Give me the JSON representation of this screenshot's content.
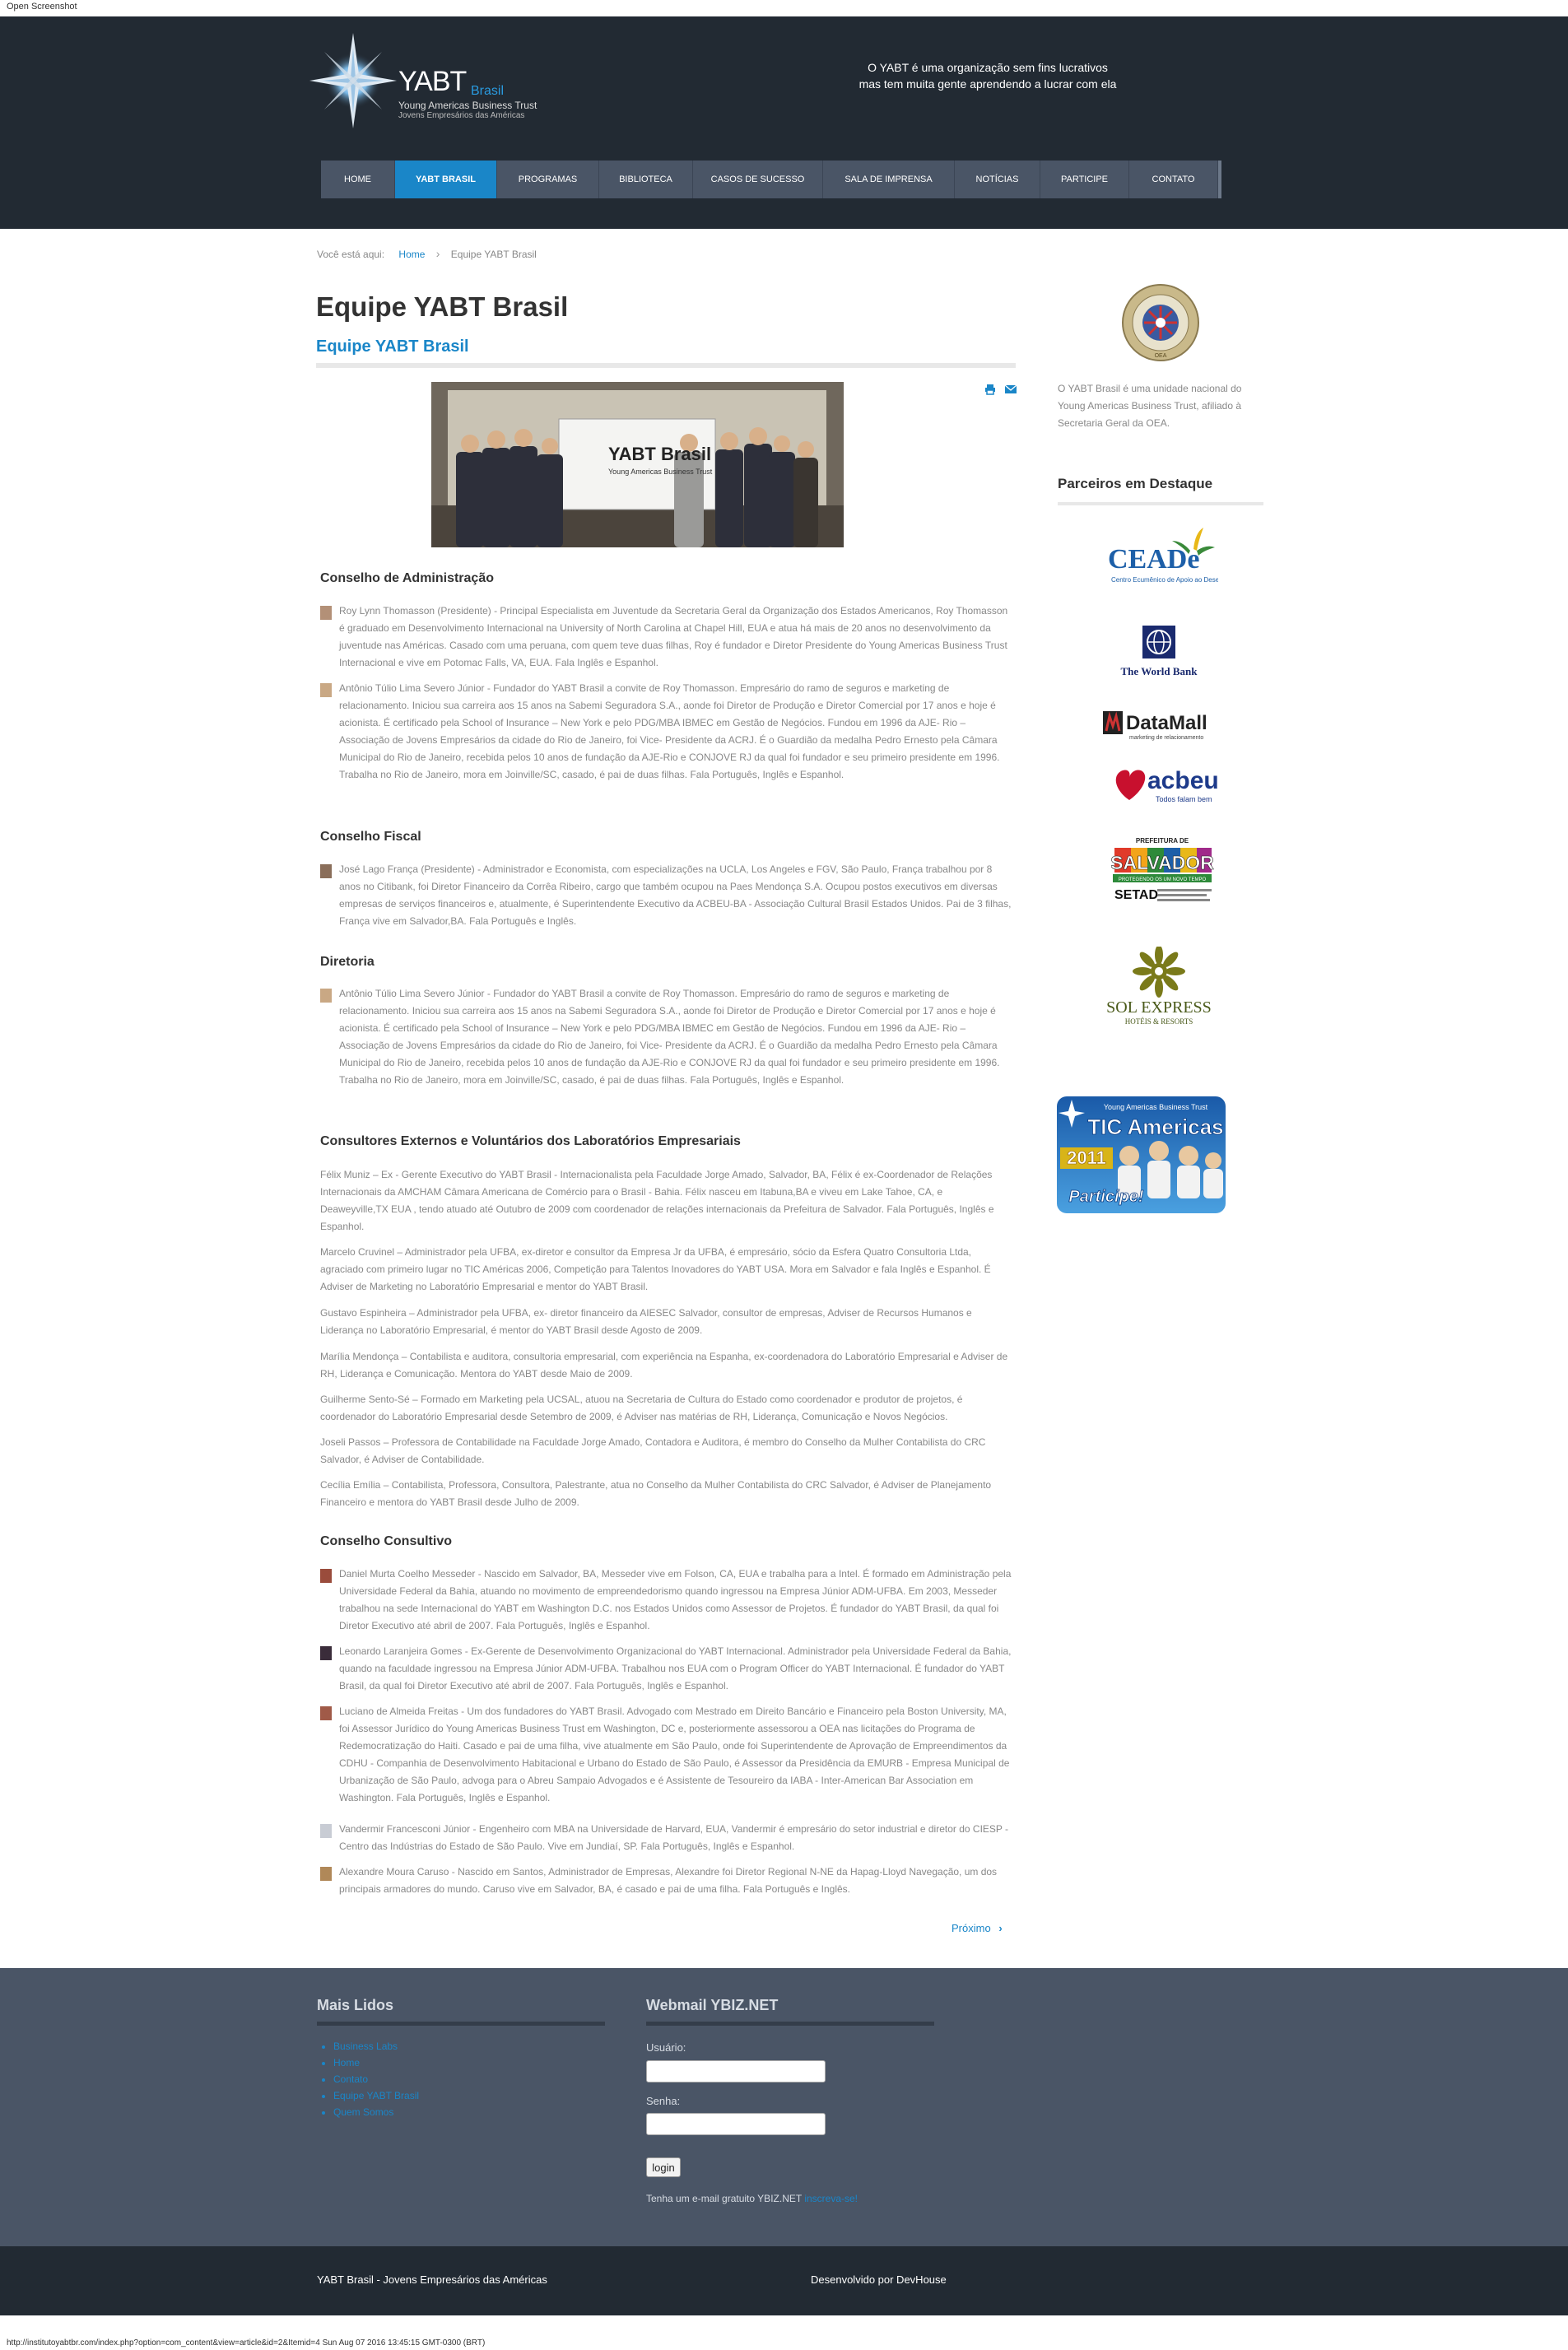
{
  "window": {
    "title": "Open Screenshot"
  },
  "header": {
    "logo": {
      "name": "YABT",
      "brasil": "Brasil",
      "line1": "Young Americas Business Trust",
      "line2": "Jovens Empresários das Américas"
    },
    "tagline_1": "O YABT é uma organização sem fins lucrativos",
    "tagline_2": "mas tem muita gente aprendendo a lucrar com ela"
  },
  "nav": {
    "items": [
      {
        "label": "HOME"
      },
      {
        "label": "YABT BRASIL"
      },
      {
        "label": "PROGRAMAS"
      },
      {
        "label": "BIBLIOTECA"
      },
      {
        "label": "CASOS DE SUCESSO"
      },
      {
        "label": "SALA DE IMPRENSA"
      },
      {
        "label": "NOTÍCIAS"
      },
      {
        "label": "PARTICIPE"
      },
      {
        "label": "CONTATO"
      }
    ],
    "active_index": 1
  },
  "breadcrumb": {
    "prefix": "Você está aqui:",
    "home": "Home",
    "current": "Equipe YABT Brasil"
  },
  "article": {
    "title": "Equipe YABT Brasil",
    "subtitle": "Equipe YABT Brasil",
    "photo_banner": "YABT Brasil",
    "photo_banner_sub": "Young Americas Business Trust",
    "icons": [
      "print-icon",
      "email-icon"
    ],
    "sections": {
      "admin": {
        "heading": "Conselho de Administração",
        "p1": "Roy Lynn Thomasson (Presidente)  - Principal Especialista em Juventude da Secretaria Geral da Organização dos Estados Americanos, Roy Thomasson é graduado em Desenvolvimento Internacional na University of North Carolina at Chapel Hill, EUA e atua há mais de 20 anos no desenvolvimento da juventude nas Américas. Casado com uma peruana, com quem teve duas filhas, Roy é fundador e Diretor Presidente do Young Americas Business Trust Internacional e vive em Potomac Falls, VA, EUA. Fala Inglês e Espanhol.",
        "p2": "Antônio Túlio Lima Severo Júnior - Fundador do YABT Brasil a convite de Roy Thomasson. Empresário do ramo de seguros e marketing de relacionamento. Iniciou sua carreira aos 15 anos na Sabemi Seguradora S.A., aonde foi Diretor de Produção e Diretor Comercial por 17 anos e hoje é acionista. É certificado pela School of Insurance – New York e pelo PDG/MBA IBMEC em Gestão de Negócios. Fundou em 1996 da AJE- Rio – Associação de Jovens Empresários da cidade do Rio de Janeiro, foi Vice- Presidente da ACRJ. É o Guardião da medalha Pedro Ernesto pela Câmara Municipal do Rio de Janeiro, recebida pelos 10 anos de fundação da AJE-Rio e CONJOVE RJ da qual foi fundador e seu primeiro presidente em 1996. Trabalha no Rio de Janeiro, mora em Joinville/SC, casado, é pai de duas filhas. Fala Português, Inglês e Espanhol."
      },
      "fiscal": {
        "heading": "Conselho Fiscal",
        "p1": "José Lago França (Presidente) - Administrador e Economista, com especializações na UCLA, Los Angeles e FGV, São Paulo, França trabalhou por 8 anos no Citibank, foi Diretor Financeiro da Corrêa Ribeiro, cargo que também ocupou na Paes Mendonça S.A. Ocupou postos executivos em diversas empresas de serviços financeiros e, atualmente, é Superintendente Executivo da ACBEU-BA - Associação Cultural Brasil Estados Unidos. Pai de 3 filhas, França vive em Salvador,BA. Fala Português e Inglês."
      },
      "diretoria": {
        "heading": "Diretoria",
        "p1": "Antônio Túlio Lima Severo Júnior - Fundador do YABT Brasil a convite de Roy Thomasson. Empresário do ramo de seguros e marketing de relacionamento. Iniciou sua carreira aos 15 anos na Sabemi Seguradora S.A., aonde foi Diretor de Produção e Diretor Comercial por 17 anos e hoje é acionista. É certificado pela School of Insurance – New York e pelo PDG/MBA IBMEC em Gestão de Negócios. Fundou em 1996 da AJE- Rio – Associação de Jovens Empresários da cidade do Rio de Janeiro, foi Vice- Presidente da ACRJ. É o Guardião da medalha Pedro Ernesto pela Câmara Municipal do Rio de Janeiro, recebida pelos 10 anos de fundação da AJE-Rio e CONJOVE RJ da qual foi fundador e seu primeiro presidente em 1996. Trabalha no Rio de Janeiro, mora em Joinville/SC, casado, é pai de duas filhas. Fala Português, Inglês e Espanhol."
      },
      "consultores": {
        "heading": "Consultores Externos e Voluntários dos Laboratórios Empresariais",
        "p1": "Félix Muniz – Ex - Gerente Executivo do YABT Brasil - Internacionalista pela Faculdade Jorge Amado, Salvador, BA, Félix é ex-Coordenador de Relações Internacionais da AMCHAM Câmara Americana de Comércio para o Brasil - Bahia. Félix nasceu em Itabuna,BA e viveu em Lake Tahoe, CA, e Deaweyville,TX EUA , tendo atuado até Outubro de 2009 com coordenador de relações internacionais da Prefeitura de Salvador. Fala Português, Inglês e Espanhol.",
        "p2": "Marcelo Cruvinel – Administrador pela UFBA, ex-diretor e consultor da Empresa Jr da UFBA, é empresário, sócio da Esfera Quatro Consultoria Ltda, agraciado com primeiro lugar no TIC Américas 2006, Competição para Talentos Inovadores do YABT USA. Mora em Salvador e fala Inglês e Espanhol. É Adviser de Marketing no Laboratório Empresarial e mentor do YABT Brasil.",
        "p3": "Gustavo Espinheira – Administrador pela UFBA, ex- diretor financeiro da AIESEC Salvador, consultor de empresas, Adviser de Recursos Humanos e Liderança no Laboratório Empresarial, é mentor do YABT Brasil desde Agosto de 2009.",
        "p4": "Marília Mendonça – Contabilista e auditora, consultoria empresarial, com experiência na Espanha, ex-coordenadora do Laboratório Empresarial e Adviser de RH, Liderança e Comunicação. Mentora do YABT desde Maio de 2009.",
        "p5": "Guilherme Sento-Sé – Formado em Marketing pela UCSAL, atuou na Secretaria de Cultura do Estado como coordenador e produtor de projetos, é coordenador do Laboratório Empresarial desde Setembro de 2009, é Adviser nas matérias de RH, Liderança, Comunicação e Novos Negócios.",
        "p6": "Joseli Passos – Professora de Contabilidade na Faculdade Jorge Amado, Contadora e Auditora, é membro do Conselho da Mulher Contabilista do CRC Salvador, é Adviser de Contabilidade.",
        "p7": "Cecília Emília – Contabilista, Professora, Consultora, Palestrante, atua no Conselho da Mulher Contabilista do CRC Salvador, é Adviser de Planejamento Financeiro e mentora do YABT Brasil desde Julho de 2009."
      },
      "consultivo": {
        "heading": "Conselho Consultivo",
        "p1": "Daniel Murta Coelho Messeder - Nascido em Salvador, BA, Messeder vive em Folson, CA, EUA e trabalha para a Intel. É formado em Administração pela Universidade Federal da Bahia, atuando no movimento de empreendedorismo quando ingressou na Empresa Júnior ADM-UFBA. Em 2003, Messeder trabalhou na sede Internacional do YABT em Washington D.C. nos Estados Unidos como Assessor de Projetos. É fundador do YABT Brasil, da qual foi Diretor Executivo até abril de 2007. Fala Português, Inglês e Espanhol.",
        "p2": "Leonardo Laranjeira Gomes - Ex-Gerente de Desenvolvimento Organizacional do YABT Internacional. Administrador pela Universidade Federal da Bahia, quando na faculdade ingressou na Empresa Júnior ADM-UFBA. Trabalhou nos EUA com o Program Officer do YABT Internacional. É fundador do YABT Brasil, da qual foi Diretor Executivo até abril de 2007. Fala Português, Inglês e Espanhol.",
        "p3": "Luciano de Almeida Freitas -  Um dos fundadores do YABT Brasil. Advogado com Mestrado em Direito Bancário e Financeiro pela Boston University, MA, foi Assessor Jurídico do Young Americas Business Trust em Washington, DC e, posteriormente assessorou a OEA nas licitações do Programa de Redemocratização do Haiti. Casado e pai de uma filha, vive atualmente em São Paulo, onde foi Superintendente de Aprovação de Empreendimentos da CDHU - Companhia de Desenvolvimento Habitacional e Urbano do Estado de São Paulo, é Assessor da Presidência da EMURB - Empresa Municipal de Urbanização de São Paulo, advoga para o Abreu Sampaio Advogados e é Assistente de Tesoureiro da IABA - Inter-American Bar Association em Washington. Fala Português, Inglês e Espanhol.",
        "p4": "Vandermir Francesconi Júnior - Engenheiro com MBA na Universidade de Harvard, EUA, Vandermir é empresário do setor industrial e diretor do CIESP - Centro das Indústrias do Estado de São Paulo. Vive em Jundiaí, SP. Fala Português, Inglês e Espanhol.",
        "p5": "Alexandre Moura Caruso - Nascido em Santos, Administrador de Empresas, Alexandre foi  Diretor Regional N-NE da Hapag-Lloyd Navegação, um dos principais armadores do mundo. Caruso vive em Salvador, BA, é casado e pai de uma filha. Fala Português e Inglês."
      }
    },
    "next_label": "Próximo"
  },
  "sidebar": {
    "seal_label": "OEA",
    "text": "O YABT Brasil é uma unidade nacional do Young Americas Business Trust, afiliado à Secretaria Geral da OEA.",
    "partners_heading": "Parceiros em Destaque",
    "partners": {
      "ceade": {
        "name": "CEADe",
        "sub": "Centro Ecumênico de Apoio ao Desenvolvimento"
      },
      "worldbank": {
        "name": "The World Bank"
      },
      "datamall": {
        "name": "DataMall",
        "sub": "marketing de relacionamento"
      },
      "acbeu": {
        "name": "acbeu",
        "sub": "Todos falam bem"
      },
      "salvador": {
        "name": "SALVADOR",
        "top": "PREFEITURA DE",
        "band": "PROTEGENDO OS UM NOVO TEMPO",
        "setad": "SETAD"
      },
      "solexpress": {
        "name": "SOL EXPRESS",
        "sub": "HOTÉIS & RESORTS"
      },
      "tic": {
        "top": "Young Americas Business Trust",
        "title": "TIC Americas",
        "year": "2011",
        "cta": "Participe!"
      }
    }
  },
  "footer": {
    "mais_lidos_heading": "Mais Lidos",
    "mais_lidos": [
      "Business Labs",
      "Home",
      "Contato",
      "Equipe YABT Brasil",
      "Quem Somos"
    ],
    "webmail_heading": "Webmail YBIZ.NET",
    "user_label": "Usuário:",
    "pass_label": "Senha:",
    "login_label": "login",
    "note_text": "Tenha um e-mail gratuito YBIZ.NET",
    "note_link": "inscreva-se!",
    "copyright": "YABT Brasil - Jovens Empresários das Américas",
    "dev": "Desenvolvido por DevHouse"
  },
  "status_bar": {
    "url": "http://institutoyabtbr.com/index.php?option=com_content&view=article&id=2&Itemid=4 Sun Aug 07 2016 13:45:15 GMT-0300 (BRT)"
  },
  "colors": {
    "header_bg": "#222a33",
    "nav_bg": "#4a5566",
    "accent": "#1a86c8",
    "footer_bg": "#4a5566"
  }
}
